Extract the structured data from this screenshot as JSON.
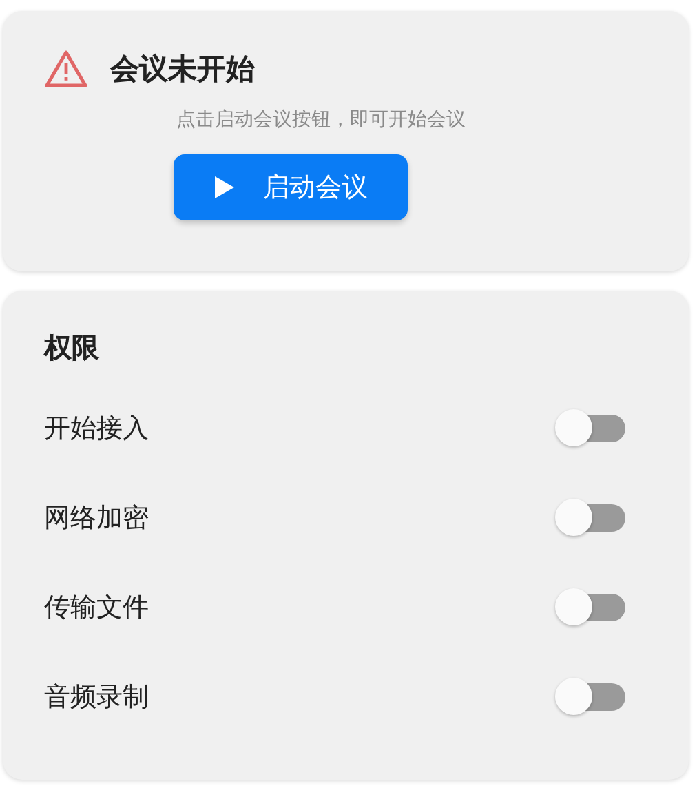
{
  "notice": {
    "title": "会议未开始",
    "hint": "点击启动会议按钮，即可开始会议",
    "button": "启动会议"
  },
  "permissions": {
    "title": "权限",
    "items": [
      {
        "label": "开始接入",
        "on": false
      },
      {
        "label": "网络加密",
        "on": false
      },
      {
        "label": "传输文件",
        "on": false
      },
      {
        "label": "音频录制",
        "on": false
      }
    ]
  }
}
